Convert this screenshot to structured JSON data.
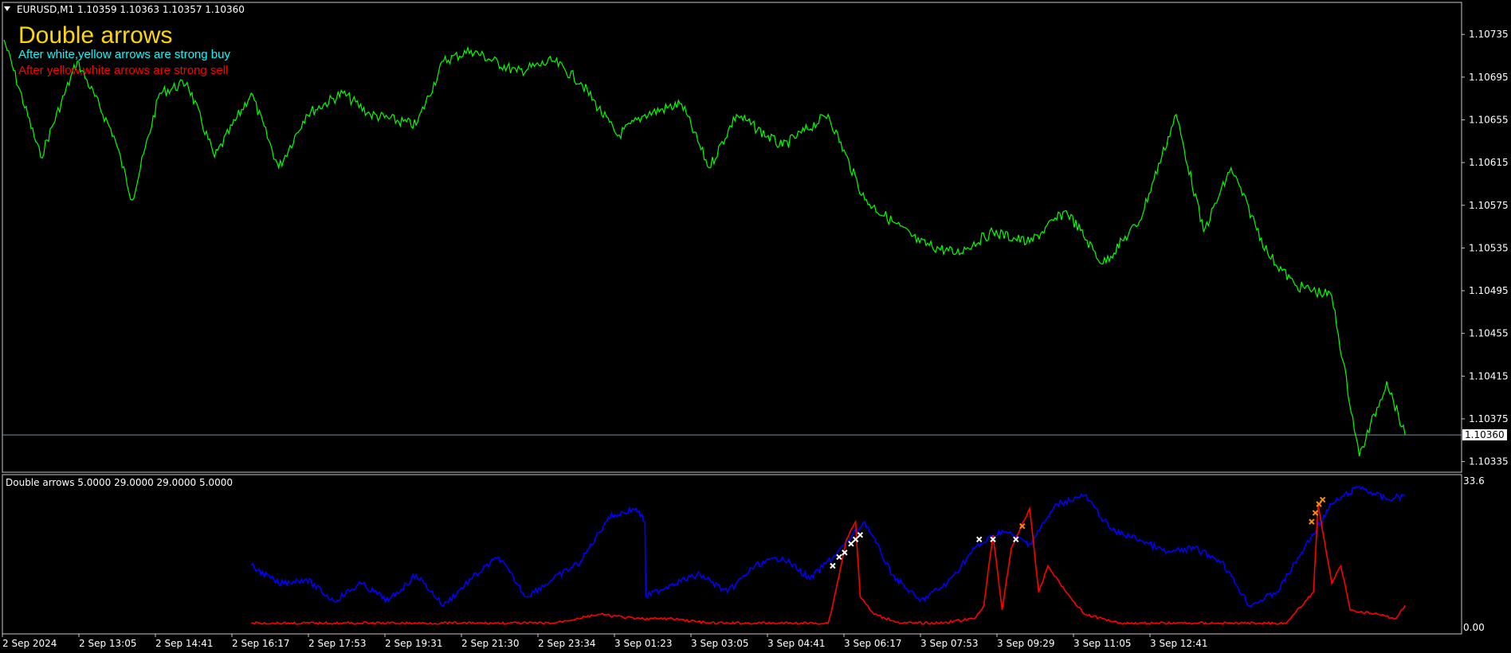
{
  "colors": {
    "background": "#000000",
    "frame": "#c8c8c8",
    "price_line": "#00ff00",
    "ask_line": "#7a8aa0",
    "indicator_blue": "#0000ff",
    "indicator_red": "#ff0000",
    "title_gold": "#ffd700",
    "buy_text": "#00ffff",
    "sell_text": "#ff0000",
    "marker_white": "#ffffff",
    "marker_orange": "#ff8c00"
  },
  "header": {
    "symbol_label": "EURUSD,M1  1.10359 1.10363 1.10357 1.10360",
    "menu_icon": "triangle-down-icon"
  },
  "annotations": {
    "title": "Double arrows",
    "buy_note": "After white,yellow arrows are strong buy",
    "sell_note": "After yellow,white arrows are strong sell"
  },
  "indicator": {
    "label": "Double arrows 5.0000 29.0000 29.0000 5.0000",
    "scale_top": "33.6",
    "scale_bottom": "0.00"
  },
  "chart_data": [
    {
      "type": "line",
      "title": "EURUSD,M1",
      "ylim": [
        1.10325,
        1.10765
      ],
      "y_ticks": [
        "1.10735",
        "1.10695",
        "1.10655",
        "1.10615",
        "1.10575",
        "1.10535",
        "1.10495",
        "1.10455",
        "1.10415",
        "1.10375",
        "1.10335"
      ],
      "current_price": "1.10360",
      "x_ticks": [
        "2 Sep 2024",
        "2 Sep 13:05",
        "2 Sep 14:41",
        "2 Sep 16:17",
        "2 Sep 17:53",
        "2 Sep 19:31",
        "2 Sep 21:30",
        "2 Sep 23:34",
        "3 Sep 01:23",
        "3 Sep 03:05",
        "3 Sep 04:41",
        "3 Sep 06:17",
        "3 Sep 07:53",
        "3 Sep 09:29",
        "3 Sep 11:05",
        "3 Sep 12:41"
      ],
      "series": [
        {
          "name": "EURUSD",
          "x": [
            0,
            0.4,
            0.8,
            1.2,
            1.4,
            1.7,
            2.0,
            2.3,
            2.7,
            3.0,
            3.3,
            3.7,
            4.0,
            4.5,
            4.8,
            5.1,
            5.6,
            6.0,
            6.3,
            6.7,
            7.0,
            7.4,
            7.7,
            8.0,
            8.5,
            9.0,
            9.4,
            9.7,
            10.0,
            10.4,
            10.8,
            11.2,
            11.6,
            12.0,
            12.4,
            12.8,
            13.1,
            13.4,
            13.8,
            14.1,
            14.5,
            14.8,
            15.1,
            15.3
          ],
          "y": [
            1.1073,
            1.1062,
            1.1071,
            1.1064,
            1.1058,
            1.1068,
            1.1069,
            1.1062,
            1.1068,
            1.1061,
            1.1066,
            1.1068,
            1.1066,
            1.1065,
            1.1071,
            1.1072,
            1.107,
            1.1071,
            1.1069,
            1.1064,
            1.1066,
            1.1067,
            1.1061,
            1.1066,
            1.1063,
            1.1066,
            1.1058,
            1.1056,
            1.1054,
            1.1053,
            1.1055,
            1.1054,
            1.1057,
            1.1052,
            1.1056,
            1.1066,
            1.1055,
            1.1061,
            1.1053,
            1.105,
            1.1049,
            1.1034,
            1.1041,
            1.1036
          ]
        }
      ]
    },
    {
      "type": "line",
      "title": "Double arrows 5.0000 29.0000 29.0000 5.0000",
      "ylim": [
        0,
        33.6
      ],
      "series": [
        {
          "name": "blue",
          "x": [
            2.7,
            3.0,
            3.3,
            3.6,
            3.9,
            4.2,
            4.5,
            4.8,
            5.1,
            5.4,
            5.7,
            6.0,
            6.3,
            6.6,
            6.9,
            7.0,
            7.01,
            7.3,
            7.6,
            7.9,
            8.2,
            8.5,
            8.8,
            9.1,
            9.4,
            9.7,
            10.0,
            10.3,
            10.6,
            10.9,
            11.2,
            11.5,
            11.8,
            12.1,
            12.4,
            12.7,
            13.0,
            13.3,
            13.6,
            13.9,
            14.2,
            14.5,
            14.8,
            15.1,
            15.3
          ],
          "y": [
            14,
            10,
            11,
            6,
            10,
            6,
            12,
            5,
            11,
            16,
            7,
            11,
            15,
            25,
            27,
            24,
            7,
            10,
            12,
            8,
            14,
            16,
            11,
            17,
            24,
            12,
            6,
            10,
            18,
            22,
            19,
            28,
            30,
            22,
            20,
            17,
            18,
            15,
            5,
            8,
            18,
            28,
            32,
            29,
            30
          ]
        },
        {
          "name": "red",
          "x": [
            2.7,
            3.0,
            3.5,
            4.0,
            4.5,
            5.0,
            5.5,
            6.0,
            6.5,
            6.9,
            7.3,
            7.7,
            8.2,
            8.6,
            9.0,
            9.05,
            9.2,
            9.3,
            9.35,
            9.5,
            9.8,
            10.2,
            10.6,
            10.7,
            10.8,
            10.9,
            11.0,
            11.2,
            11.3,
            11.4,
            11.6,
            11.8,
            12.2,
            12.6,
            13.0,
            13.5,
            14.0,
            14.3,
            14.35,
            14.5,
            14.6,
            14.7,
            15.0,
            15.2,
            15.3
          ],
          "y": [
            1,
            1,
            1,
            1,
            1,
            1,
            1,
            1,
            3,
            2,
            2,
            1,
            1,
            1,
            1,
            5,
            20,
            24,
            7,
            3,
            1,
            1,
            2,
            5,
            21,
            4,
            18,
            27,
            8,
            14,
            8,
            3,
            1,
            1,
            1,
            1,
            1,
            8,
            28,
            10,
            14,
            4,
            3,
            2,
            5
          ]
        }
      ]
    }
  ]
}
